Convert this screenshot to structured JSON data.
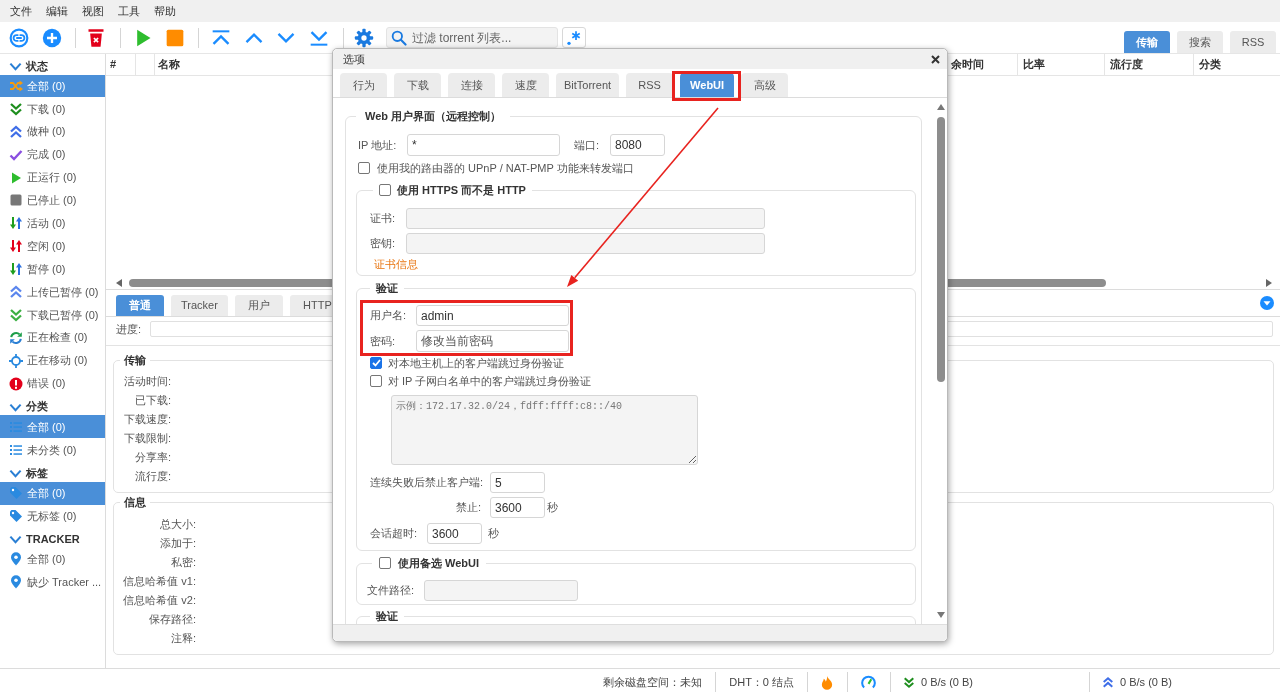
{
  "menu_bar": [
    "文件",
    "编辑",
    "视图",
    "工具",
    "帮助"
  ],
  "toolbar": {
    "search": {
      "placeholder": "过滤 torrent 列表..."
    }
  },
  "view_tabs": [
    {
      "label": "传输",
      "selected": true
    },
    {
      "label": "搜索",
      "selected": false
    },
    {
      "label": "RSS",
      "selected": false
    }
  ],
  "sidebar": [
    {
      "title": "状态",
      "expanded": true,
      "items": [
        {
          "label": "全部 (0)",
          "selected": true
        },
        {
          "label": "下载 (0)",
          "selected": false
        },
        {
          "label": "做种 (0)",
          "selected": false
        },
        {
          "label": "完成 (0)",
          "selected": false
        },
        {
          "label": "正运行 (0)",
          "selected": false
        },
        {
          "label": "已停止 (0)",
          "selected": false
        },
        {
          "label": "活动 (0)",
          "selected": false
        },
        {
          "label": "空闲 (0)",
          "selected": false
        },
        {
          "label": "暂停 (0)",
          "selected": false
        },
        {
          "label": "上传已暂停 (0)",
          "selected": false
        },
        {
          "label": "下载已暂停 (0)",
          "selected": false
        },
        {
          "label": "正在检查 (0)",
          "selected": false
        },
        {
          "label": "正在移动 (0)",
          "selected": false
        },
        {
          "label": "错误 (0)",
          "selected": false
        }
      ]
    },
    {
      "title": "分类",
      "expanded": true,
      "items": [
        {
          "label": "全部 (0)",
          "selected": true
        },
        {
          "label": "未分类 (0)",
          "selected": false
        }
      ]
    },
    {
      "title": "标签",
      "expanded": true,
      "items": [
        {
          "label": "全部 (0)",
          "selected": true
        },
        {
          "label": "无标签 (0)",
          "selected": false
        }
      ]
    },
    {
      "title": "TRACKER",
      "expanded": true,
      "items": [
        {
          "label": "全部 (0)",
          "selected": false
        },
        {
          "label": "缺少 Tracker ...",
          "selected": false
        }
      ]
    }
  ],
  "torrent_table": {
    "columns": [
      "#",
      "名称",
      "余时间",
      "比率",
      "流行度",
      "分类"
    ]
  },
  "details": {
    "tabs": [
      {
        "label": "普通",
        "selected": true
      },
      {
        "label": "Tracker",
        "selected": false
      },
      {
        "label": "用户",
        "selected": false
      },
      {
        "label": "HTTP",
        "selected": false
      }
    ],
    "progress": {
      "label": "进度:",
      "level": 0
    },
    "groups": [
      {
        "title": "传输",
        "fields": [
          "活动时间:",
          "已下载:",
          "下载速度:",
          "下载限制:",
          "分享率:",
          "流行度:"
        ]
      },
      {
        "title": "信息",
        "fields": [
          "总大小:",
          "添加于:",
          "私密:",
          "信息哈希值 v1:",
          "信息哈希值 v2:",
          "保存路径:",
          "注释:"
        ]
      }
    ]
  },
  "dialog": {
    "title": "选项",
    "tabs": [
      {
        "label": "行为",
        "selected": false,
        "highlighted": false
      },
      {
        "label": "下载",
        "selected": false,
        "highlighted": false
      },
      {
        "label": "连接",
        "selected": false,
        "highlighted": false
      },
      {
        "label": "速度",
        "selected": false,
        "highlighted": false
      },
      {
        "label": "BitTorrent",
        "selected": false,
        "highlighted": false
      },
      {
        "label": "RSS",
        "selected": false,
        "highlighted": false
      },
      {
        "label": "WebUI",
        "selected": true,
        "highlighted": true
      },
      {
        "label": "高级",
        "selected": false,
        "highlighted": false
      }
    ],
    "web_ui": {
      "legend": "Web 用户界面（远程控制）",
      "ip_label": "IP 地址:",
      "ip_address": "*",
      "port_label": "端口:",
      "port": "8080",
      "upnp": {
        "label": "使用我的路由器的 UPnP / NAT-PMP 功能来转发端口",
        "checked": false
      },
      "https": {
        "label": "使用 HTTPS 而不是 HTTP",
        "checked": false,
        "certificate_label": "证书:",
        "key_label": "密钥:",
        "info_link": "证书信息"
      },
      "authentication": {
        "legend": "验证",
        "highlighted": true,
        "username_label": "用户名:",
        "username": "admin",
        "password_label": "密码:",
        "password_placeholder": "修改当前密码",
        "bypass_localhost": {
          "label": "对本地主机上的客户端跳过身份验证",
          "checked": true
        },
        "bypass_whitelist": {
          "label": "对 IP 子网白名单中的客户端跳过身份验证",
          "checked": false
        },
        "whitelist_placeholder": "示例：172.17.32.0/24，fdff:ffff:c8::/40",
        "ban_after_label": "连续失败后禁止客户端:",
        "ban_after": "5",
        "ban_for_label": "禁止:",
        "ban_for": "3600",
        "ban_for_unit": "秒",
        "session_timeout_label": "会话超时:",
        "session_timeout": "3600",
        "session_timeout_unit": "秒"
      },
      "alternative_webui": {
        "label": "使用备选 WebUI",
        "checked": false,
        "path_label": "文件路径:"
      },
      "next_section_legend": "验证"
    }
  },
  "status_bar": {
    "free_space": "剩余磁盘空间：未知",
    "dht": "DHT：0 结点",
    "download": "0 B/s (0 B)",
    "upload": "0 B/s (0 B)"
  }
}
